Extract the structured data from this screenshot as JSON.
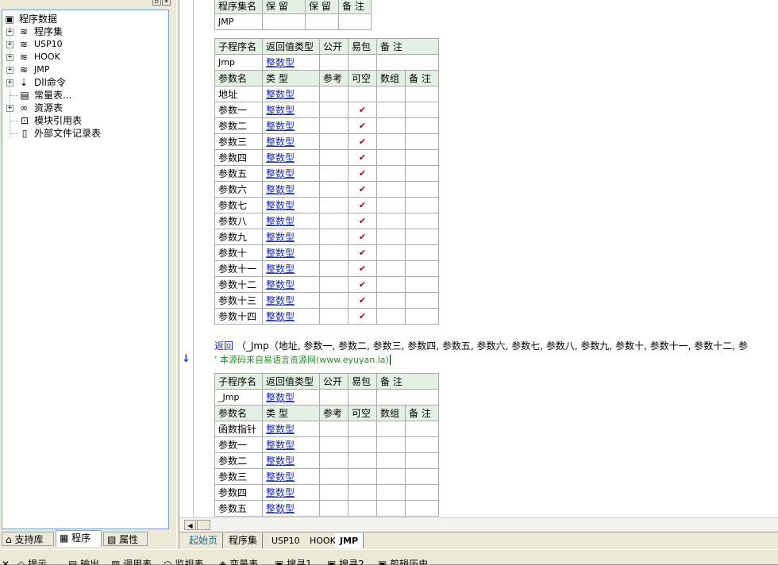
{
  "tree": {
    "root": "程序数据",
    "items": [
      {
        "label": "程序集",
        "icon": "stack-icon"
      },
      {
        "label": "USP10",
        "icon": "stack-icon"
      },
      {
        "label": "HOOK",
        "icon": "stack-icon"
      },
      {
        "label": "JMP",
        "icon": "stack-icon"
      },
      {
        "label": "Dll命令",
        "icon": "dll-icon"
      },
      {
        "label": "常量表...",
        "icon": "constant-icon"
      },
      {
        "label": "资源表",
        "icon": "resource-icon"
      },
      {
        "label": "模块引用表",
        "icon": "module-icon"
      },
      {
        "label": "外部文件记录表",
        "icon": "file-icon"
      }
    ]
  },
  "left_tabs": [
    "支持库",
    "程序",
    "属性"
  ],
  "assembly_table": {
    "headers": [
      "程序集名",
      "保 留",
      "保 留",
      "备 注"
    ],
    "row": [
      "JMP",
      "",
      "",
      ""
    ]
  },
  "sub1": {
    "headers": [
      "子程序名",
      "返回值类型",
      "公开",
      "易包",
      "备 注"
    ],
    "row": [
      "Jmp",
      "整数型",
      "",
      "",
      ""
    ],
    "param_headers": [
      "参数名",
      "类 型",
      "参考",
      "可空",
      "数组",
      "备 注"
    ],
    "params": [
      {
        "name": "地址",
        "type": "整数型",
        "nullable": ""
      },
      {
        "name": "参数一",
        "type": "整数型",
        "nullable": "✔"
      },
      {
        "name": "参数二",
        "type": "整数型",
        "nullable": "✔"
      },
      {
        "name": "参数三",
        "type": "整数型",
        "nullable": "✔"
      },
      {
        "name": "参数四",
        "type": "整数型",
        "nullable": "✔"
      },
      {
        "name": "参数五",
        "type": "整数型",
        "nullable": "✔"
      },
      {
        "name": "参数六",
        "type": "整数型",
        "nullable": "✔"
      },
      {
        "name": "参数七",
        "type": "整数型",
        "nullable": "✔"
      },
      {
        "name": "参数八",
        "type": "整数型",
        "nullable": "✔"
      },
      {
        "name": "参数九",
        "type": "整数型",
        "nullable": "✔"
      },
      {
        "name": "参数十",
        "type": "整数型",
        "nullable": "✔"
      },
      {
        "name": "参数十一",
        "type": "整数型",
        "nullable": "✔"
      },
      {
        "name": "参数十二",
        "type": "整数型",
        "nullable": "✔"
      },
      {
        "name": "参数十三",
        "type": "整数型",
        "nullable": "✔"
      },
      {
        "name": "参数十四",
        "type": "整数型",
        "nullable": "✔"
      }
    ]
  },
  "code": {
    "return_kw": "返回",
    "return_call": "（_Jmp（地址, 参数一, 参数二, 参数三, 参数四, 参数五, 参数六, 参数七, 参数八, 参数九, 参数十, 参数十一, 参数十二, 参",
    "comment": "’ 本源码来自易语言资源网(www.eyuyan.la)"
  },
  "sub2": {
    "headers": [
      "子程序名",
      "返回值类型",
      "公开",
      "易包",
      "备 注"
    ],
    "row": [
      "_Jmp",
      "整数型",
      "",
      "",
      ""
    ],
    "param_headers": [
      "参数名",
      "类 型",
      "参考",
      "可空",
      "数组",
      "备 注"
    ],
    "params": [
      {
        "name": "函数指针",
        "type": "整数型"
      },
      {
        "name": "参数一",
        "type": "整数型"
      },
      {
        "name": "参数二",
        "type": "整数型"
      },
      {
        "name": "参数三",
        "type": "整数型"
      },
      {
        "name": "参数四",
        "type": "整数型"
      },
      {
        "name": "参数五",
        "type": "整数型"
      }
    ]
  },
  "file_tabs": [
    "起始页",
    "程序集",
    "USP10",
    "HOOK",
    "JMP"
  ],
  "bottom_tabs": [
    "提示",
    "输出",
    "调用表",
    "监视表",
    "变量表",
    "搜寻1",
    "搜寻2",
    "剪辑历史"
  ],
  "colors": {
    "type_link": "#1c2fa8",
    "header_bg": "#e4f0e4",
    "check": "#9a1010",
    "comment": "#2a8a2a"
  }
}
